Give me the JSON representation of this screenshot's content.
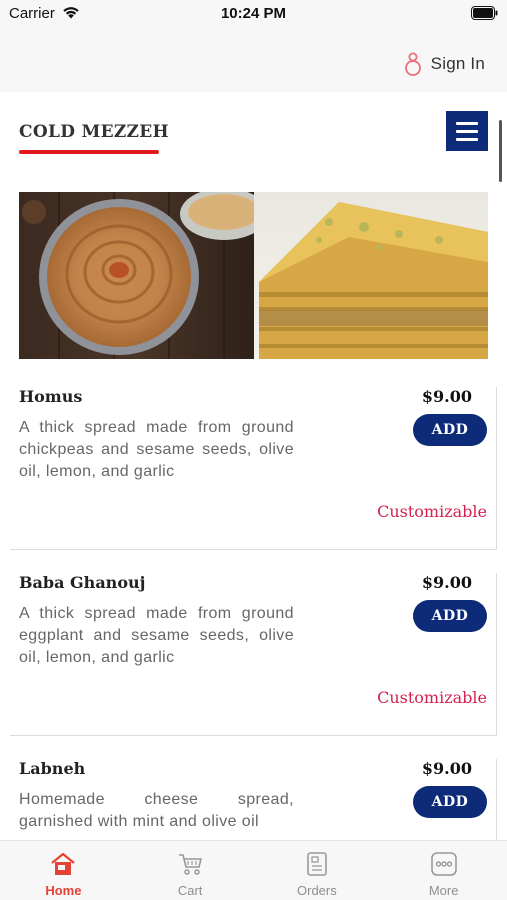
{
  "status_bar": {
    "carrier": "Carrier",
    "time": "10:24 PM"
  },
  "header": {
    "signin_label": "Sign In"
  },
  "category": {
    "title": "COLD MEZZEH"
  },
  "colors": {
    "brand_navy": "#0e2b7a",
    "accent_red": "#e0191f",
    "customizable_pink": "#d3214f",
    "active_tab": "#e34234"
  },
  "items": [
    {
      "name": "Homus",
      "price": "$9.00",
      "description": "A thick spread made from ground chickpeas and sesame seeds, olive oil, lemon, and garlic",
      "add_label": "ADD",
      "customizable": "Customizable"
    },
    {
      "name": "Baba Ghanouj",
      "price": "$9.00",
      "description": "A thick spread made from ground eggplant and sesame seeds, olive oil, lemon, and garlic",
      "add_label": "ADD",
      "customizable": "Customizable"
    },
    {
      "name": "Labneh",
      "price": "$9.00",
      "description": "Homemade cheese spread, garnished with mint and olive oil",
      "add_label": "ADD"
    }
  ],
  "tabs": [
    {
      "label": "Home",
      "icon": "home-icon",
      "active": true
    },
    {
      "label": "Cart",
      "icon": "cart-icon",
      "active": false
    },
    {
      "label": "Orders",
      "icon": "orders-icon",
      "active": false
    },
    {
      "label": "More",
      "icon": "more-icon",
      "active": false
    }
  ]
}
